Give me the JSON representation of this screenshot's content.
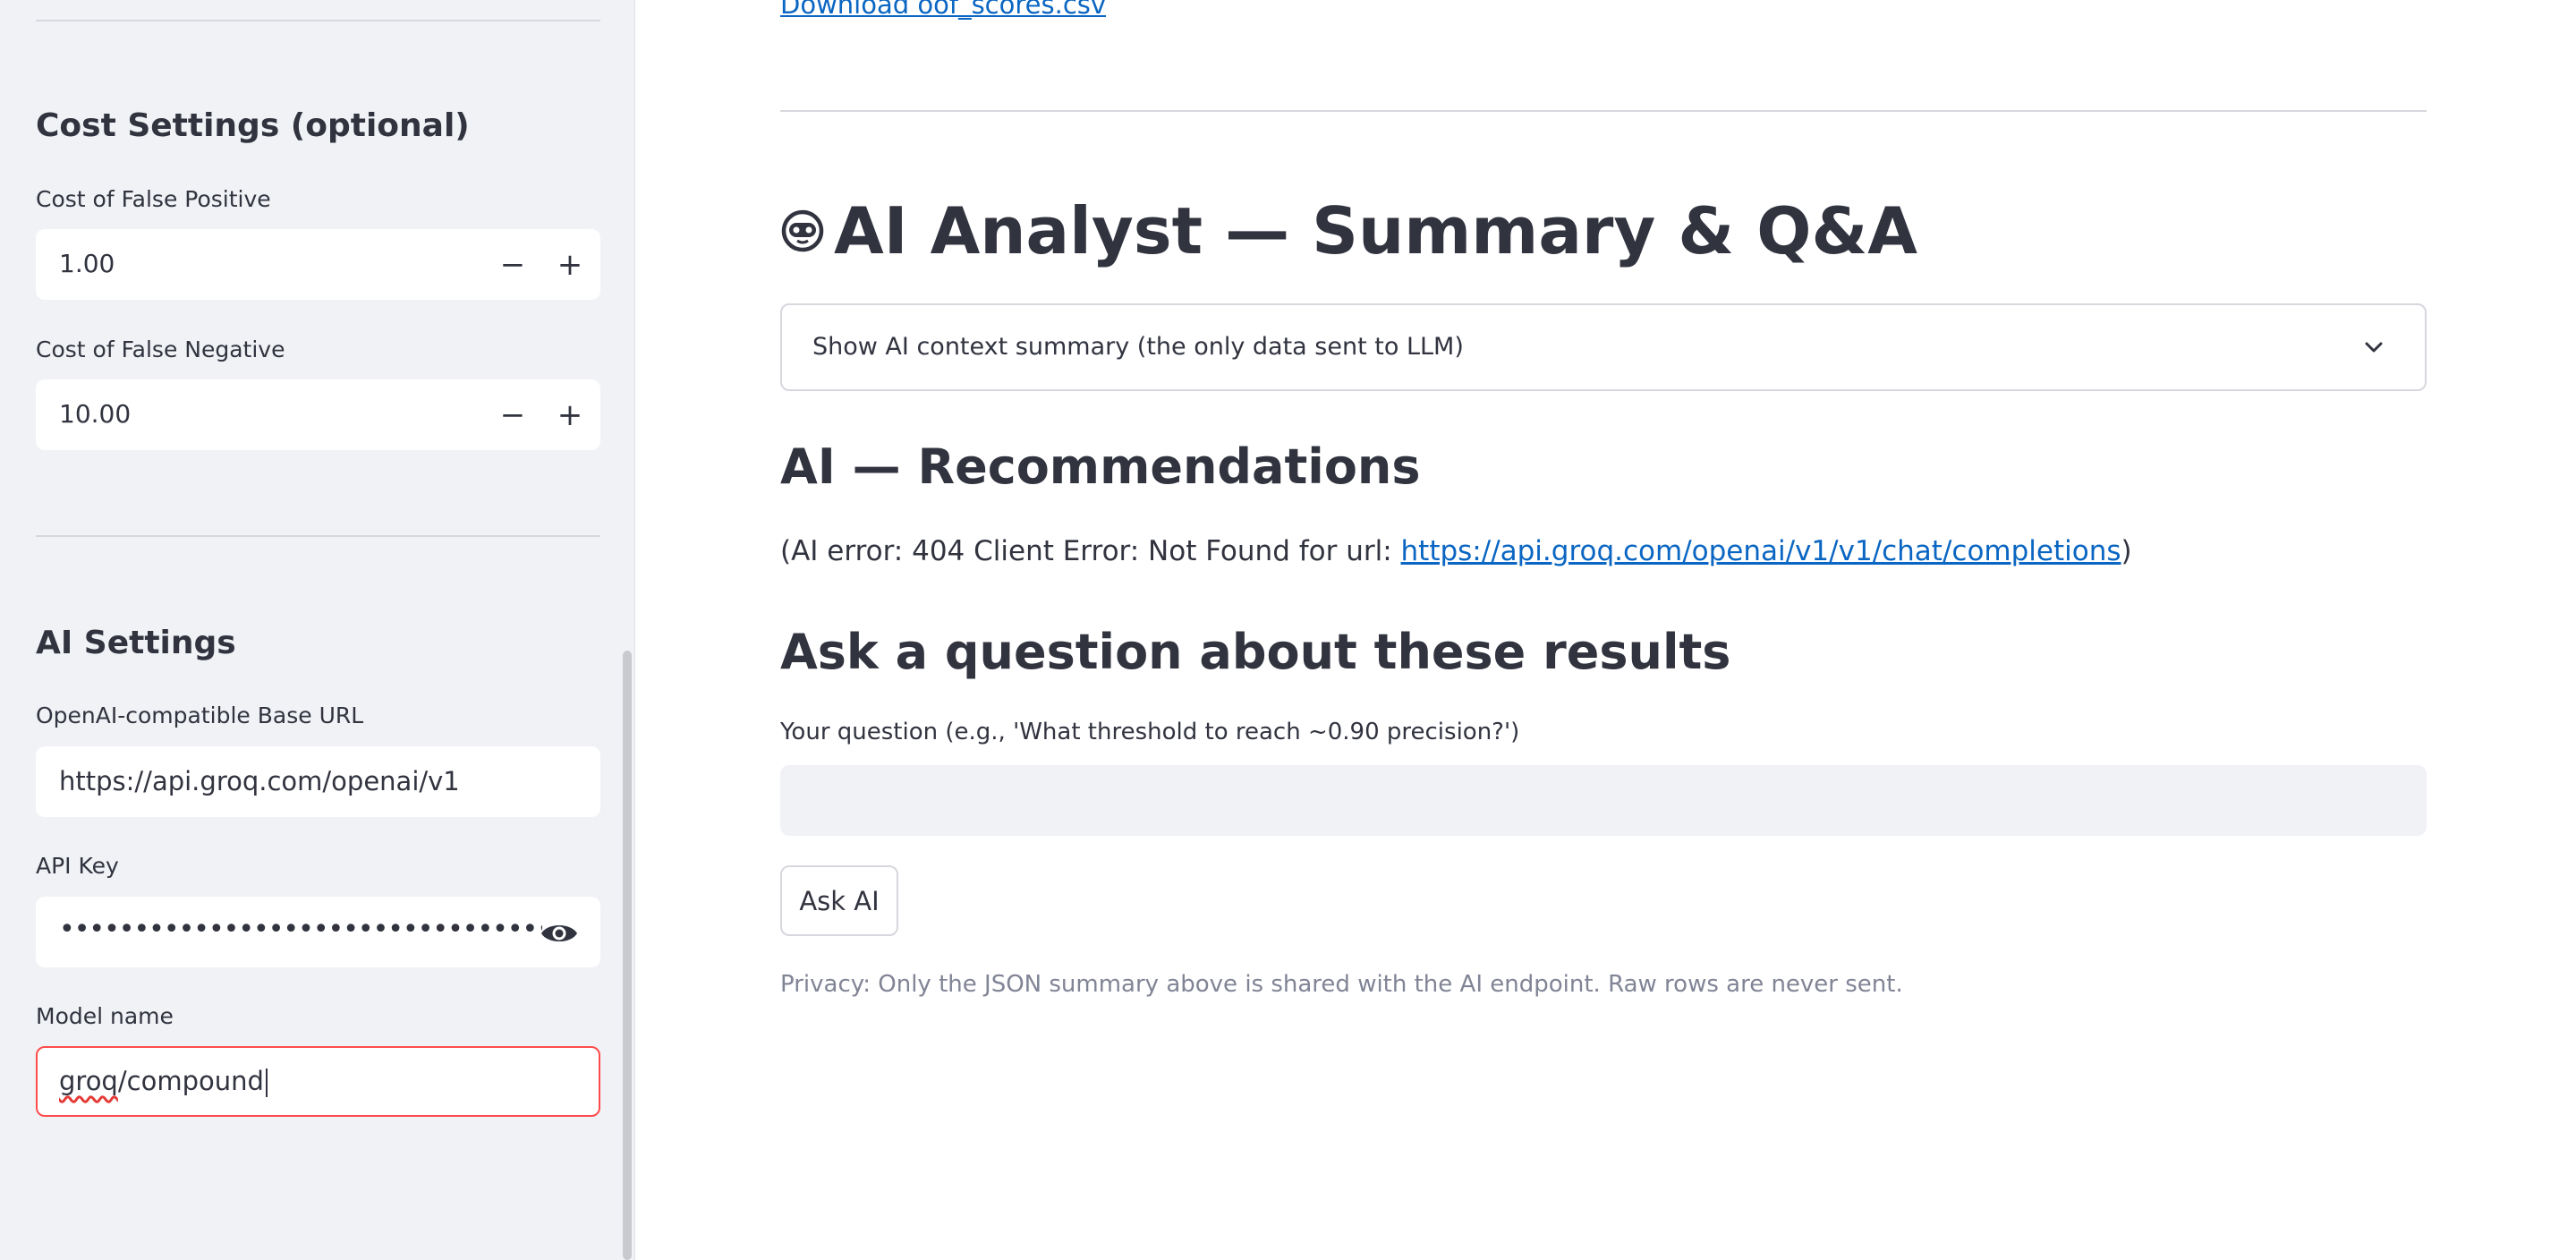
{
  "sidebar": {
    "cost_section": {
      "title": "Cost Settings (optional)",
      "false_positive": {
        "label": "Cost of False Positive",
        "value": "1.00",
        "minus": "−",
        "plus": "+"
      },
      "false_negative": {
        "label": "Cost of False Negative",
        "value": "10.00",
        "minus": "−",
        "plus": "+"
      }
    },
    "ai_section": {
      "title": "AI Settings",
      "base_url": {
        "label": "OpenAI-compatible Base URL",
        "value": "https://api.groq.com/openai/v1"
      },
      "api_key": {
        "label": "API Key",
        "masked_value": "••••••••••••••••••••••••••••••••••••••••••••••••••••",
        "toggle_icon": "eye-icon"
      },
      "model": {
        "label": "Model name",
        "value_part1": "groq",
        "value_part2": "/compound"
      }
    }
  },
  "main": {
    "download_link": "Download oof_scores.csv",
    "analyst": {
      "icon": "robot-face-icon",
      "title": "AI Analyst — Summary & Q&A",
      "expander_label": "Show AI context summary (the only data sent to LLM)"
    },
    "recommendations": {
      "title": "AI — Recommendations",
      "error_prefix": "(AI error: 404 Client Error: Not Found for url: ",
      "error_url": "https://api.groq.com/openai/v1/v1/chat/completions",
      "error_suffix": ")"
    },
    "question": {
      "title": "Ask a question about these results",
      "label": "Your question (e.g., 'What threshold to reach ~0.90 precision?')",
      "value": "",
      "button": "Ask AI"
    },
    "privacy_caption": "Privacy: Only the JSON summary above is shared with the AI endpoint. Raw rows are never sent."
  },
  "colors": {
    "sidebar_bg": "#f0f2f6",
    "text": "#31333f",
    "link": "#0a66c2",
    "focus_border": "#ff4b4b",
    "caption": "#808495"
  }
}
